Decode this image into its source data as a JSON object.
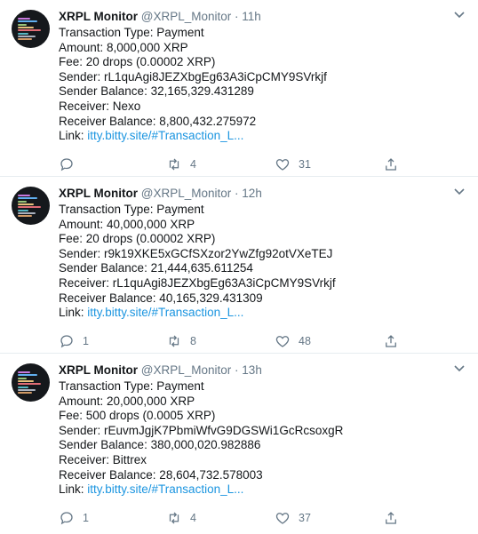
{
  "icons": {
    "reply": "reply-icon",
    "retweet": "retweet-icon",
    "like": "heart-icon",
    "share": "share-icon",
    "more": "chevron-down-icon"
  },
  "colors": {
    "link": "#1b95e0",
    "muted": "#657786",
    "text": "#14171a",
    "divider": "#e6ecf0"
  },
  "tweets": [
    {
      "name": "XRPL Monitor",
      "handle": "@XRPL_Monitor",
      "dot": "·",
      "time": "11h",
      "lines": [
        "Transaction Type: Payment",
        "Amount: 8,000,000 XRP",
        "Fee: 20 drops (0.00002 XRP)",
        "Sender: rL1quAgi8JEZXbgEg63A3iCpCMY9SVrkjf",
        "Sender Balance: 32,165,329.431289",
        "Receiver: Nexo",
        "Receiver Balance: 8,800,432.275972"
      ],
      "link_label": "Link: ",
      "link_text": "itty.bitty.site/#Transaction_L...",
      "replies": "",
      "retweets": "4",
      "likes": "31"
    },
    {
      "name": "XRPL Monitor",
      "handle": "@XRPL_Monitor",
      "dot": "·",
      "time": "12h",
      "lines": [
        "Transaction Type: Payment",
        "Amount: 40,000,000 XRP",
        "Fee: 20 drops (0.00002 XRP)",
        "Sender: r9k19XKE5xGCfSXzor2YwZfg92otVXeTEJ",
        "Sender Balance: 21,444,635.611254",
        "Receiver: rL1quAgi8JEZXbgEg63A3iCpCMY9SVrkjf",
        "Receiver Balance: 40,165,329.431309"
      ],
      "link_label": "Link: ",
      "link_text": "itty.bitty.site/#Transaction_L...",
      "replies": "1",
      "retweets": "8",
      "likes": "48"
    },
    {
      "name": "XRPL Monitor",
      "handle": "@XRPL_Monitor",
      "dot": "·",
      "time": "13h",
      "lines": [
        "Transaction Type: Payment",
        "Amount: 20,000,000 XRP",
        "Fee: 500 drops (0.0005 XRP)",
        "Sender: rEuvmJgjK7PbmiWfvG9DGSWi1GcRcsoxgR",
        "Sender Balance: 380,000,020.982886",
        "Receiver: Bittrex",
        "Receiver Balance: 28,604,732.578003"
      ],
      "link_label": "Link: ",
      "link_text": "itty.bitty.site/#Transaction_L...",
      "replies": "1",
      "retweets": "4",
      "likes": "37"
    }
  ]
}
